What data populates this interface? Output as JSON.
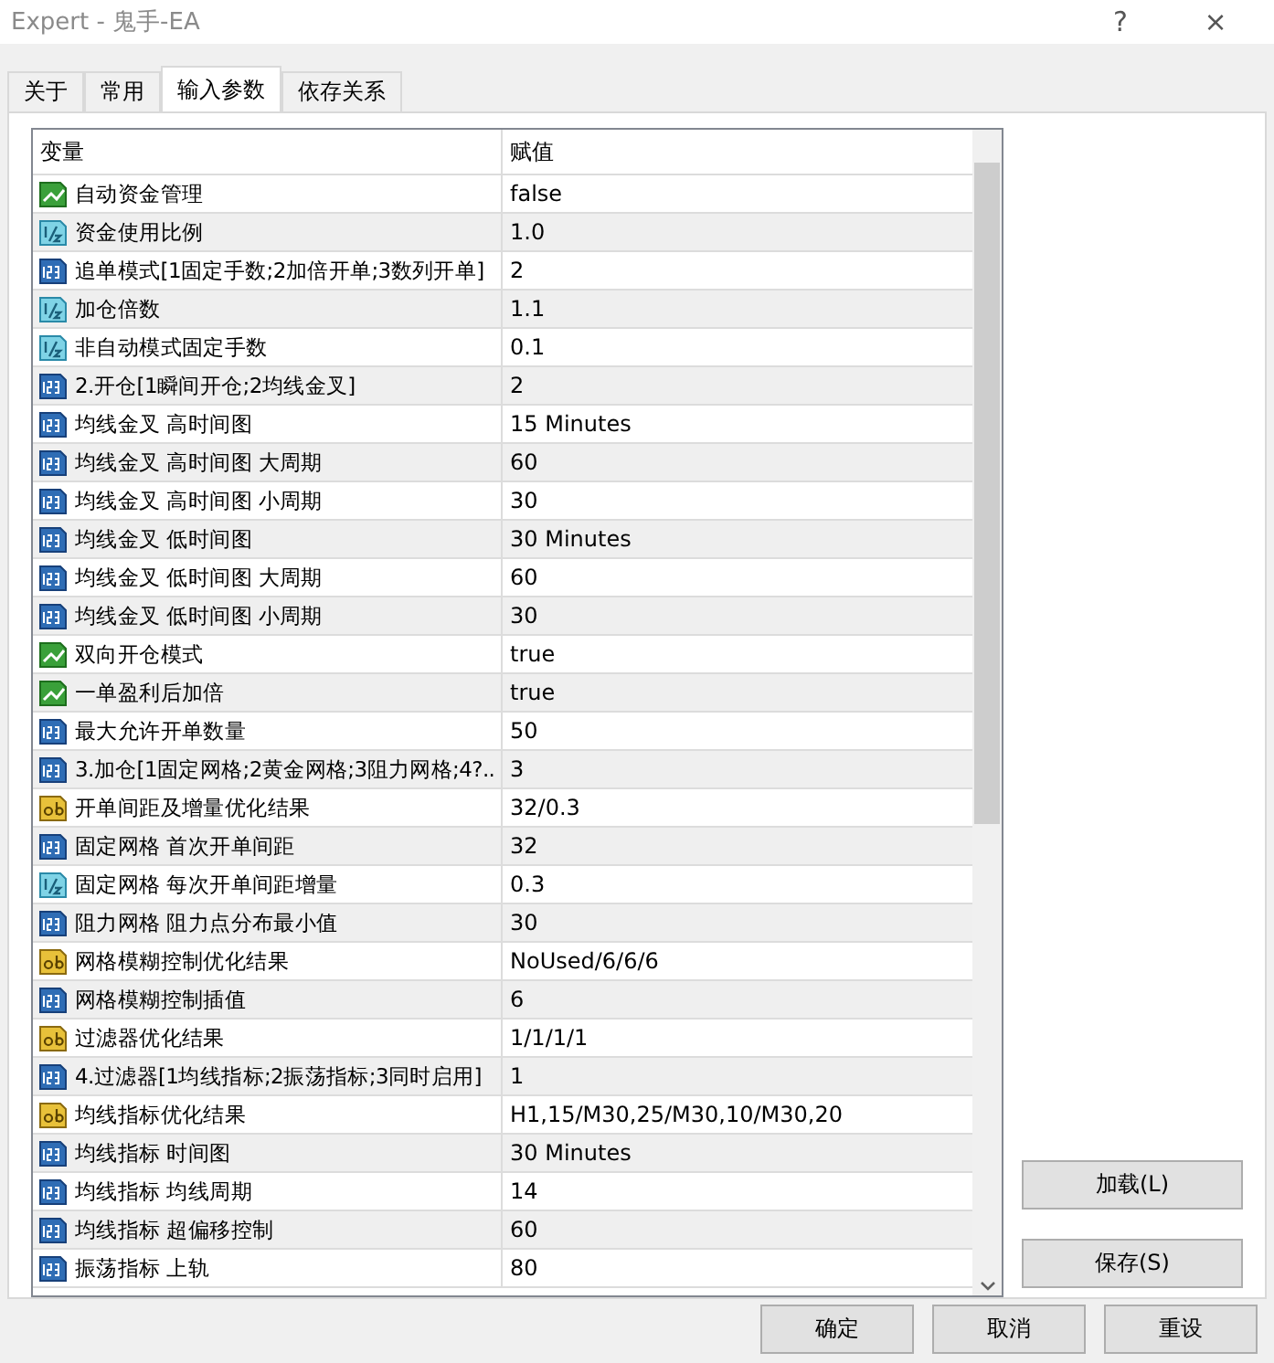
{
  "window": {
    "title": "Expert - 鬼手-EA",
    "help": "?",
    "close": "×"
  },
  "tabs": [
    {
      "label": "关于",
      "selected": false
    },
    {
      "label": "常用",
      "selected": false
    },
    {
      "label": "输入参数",
      "selected": true
    },
    {
      "label": "依存关系",
      "selected": false
    }
  ],
  "table": {
    "columns": [
      "变量",
      "赋值"
    ],
    "rows": [
      {
        "kind": "bool",
        "name": "自动资金管理",
        "value": "false"
      },
      {
        "kind": "double",
        "name": "资金使用比例",
        "value": "1.0"
      },
      {
        "kind": "int",
        "name": "追单模式[1固定手数;2加倍开单;3数列开单]",
        "value": "2"
      },
      {
        "kind": "double",
        "name": "加仓倍数",
        "value": "1.1"
      },
      {
        "kind": "double",
        "name": "非自动模式固定手数",
        "value": "0.1"
      },
      {
        "kind": "int",
        "name": "2.开仓[1瞬间开仓;2均线金叉]",
        "value": "2"
      },
      {
        "kind": "int",
        "name": "均线金叉 高时间图",
        "value": "15 Minutes"
      },
      {
        "kind": "int",
        "name": "均线金叉 高时间图 大周期",
        "value": "60"
      },
      {
        "kind": "int",
        "name": "均线金叉 高时间图 小周期",
        "value": "30"
      },
      {
        "kind": "int",
        "name": "均线金叉 低时间图",
        "value": "30 Minutes"
      },
      {
        "kind": "int",
        "name": "均线金叉 低时间图 大周期",
        "value": "60"
      },
      {
        "kind": "int",
        "name": "均线金叉 低时间图 小周期",
        "value": "30"
      },
      {
        "kind": "bool",
        "name": "双向开仓模式",
        "value": "true"
      },
      {
        "kind": "bool",
        "name": "一单盈利后加倍",
        "value": "true"
      },
      {
        "kind": "int",
        "name": "最大允许开单数量",
        "value": "50"
      },
      {
        "kind": "int",
        "name": "3.加仓[1固定网格;2黄金网格;3阻力网格;4?..",
        "value": "3"
      },
      {
        "kind": "string",
        "name": "开单间距及增量优化结果",
        "value": "32/0.3"
      },
      {
        "kind": "int",
        "name": "固定网格 首次开单间距",
        "value": "32"
      },
      {
        "kind": "double",
        "name": "固定网格 每次开单间距增量",
        "value": "0.3"
      },
      {
        "kind": "int",
        "name": "阻力网格 阻力点分布最小值",
        "value": "30"
      },
      {
        "kind": "string",
        "name": "网格模糊控制优化结果",
        "value": "NoUsed/6/6/6"
      },
      {
        "kind": "int",
        "name": "网格模糊控制插值",
        "value": "6"
      },
      {
        "kind": "string",
        "name": "过滤器优化结果",
        "value": "1/1/1/1"
      },
      {
        "kind": "int",
        "name": "4.过滤器[1均线指标;2振荡指标;3同时启用]",
        "value": "1"
      },
      {
        "kind": "string",
        "name": "均线指标优化结果",
        "value": "H1,15/M30,25/M30,10/M30,20"
      },
      {
        "kind": "int",
        "name": "均线指标 时间图",
        "value": "30 Minutes"
      },
      {
        "kind": "int",
        "name": "均线指标 均线周期",
        "value": "14"
      },
      {
        "kind": "int",
        "name": "均线指标 超偏移控制",
        "value": "60"
      },
      {
        "kind": "int",
        "name": "振荡指标 上轨",
        "value": "80"
      }
    ]
  },
  "side_buttons": [
    "加载(L)",
    "保存(S)"
  ],
  "buttons": [
    "确定",
    "取消",
    "重设"
  ]
}
